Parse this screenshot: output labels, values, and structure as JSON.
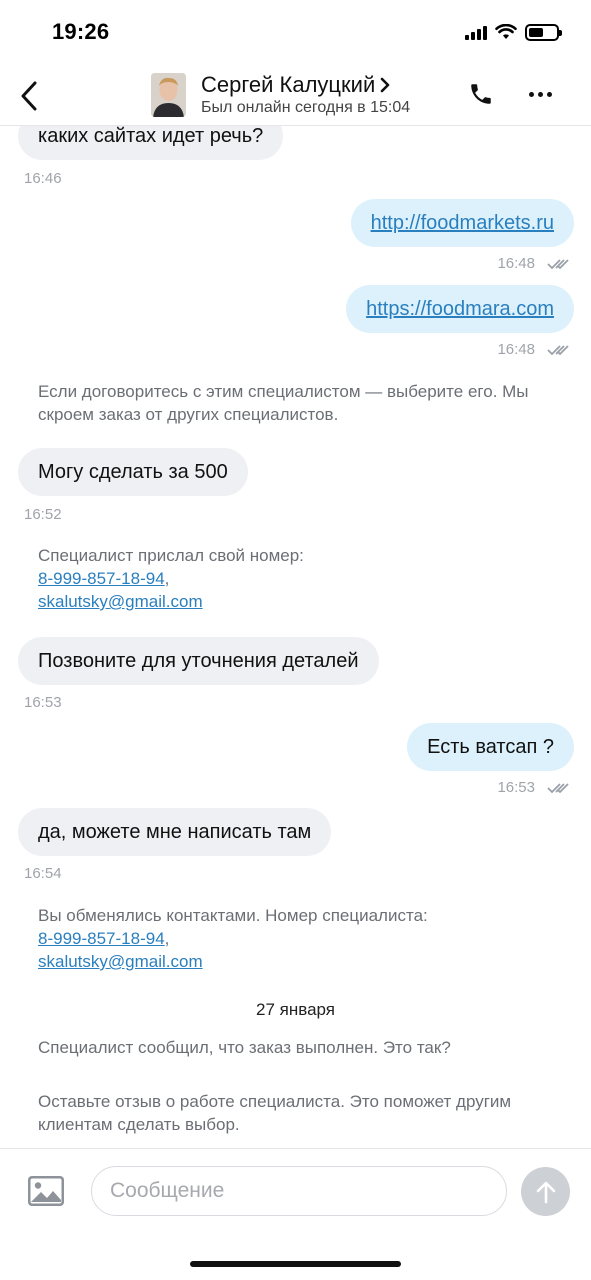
{
  "status_bar": {
    "time": "19:26",
    "battery_level": 0.55
  },
  "header": {
    "contact_name": "Сергей Калуцкий",
    "contact_status": "Был онлайн сегодня в 15:04",
    "icons": {
      "back": "chevron-left-icon",
      "call": "phone-icon",
      "more": "more-dots-icon",
      "name_chevron": "chevron-right-icon"
    }
  },
  "messages": {
    "m1_text": "каких сайтах идет речь?",
    "m1_time": "16:46",
    "m2_link": "http://foodmarkets.ru",
    "m2_time": "16:48",
    "m3_link": "https://foodmara.com",
    "m3_time": "16:48",
    "sys1": "Если договоритесь с этим специалистом — выберите его. Мы скроем заказ от других специалистов.",
    "m4_text": "Могу сделать за 500",
    "m4_time": "16:52",
    "sys2_text": "Специалист прислал свой номер:",
    "sys2_phone": "8-999-857-18-94",
    "sys2_email": "skalutsky@gmail.com",
    "m5_text": "Позвоните для уточнения деталей",
    "m5_time": "16:53",
    "m6_text": "Есть ватсап ?",
    "m6_time": "16:53",
    "m7_text": "да, можете мне написать там",
    "m7_time": "16:54",
    "sys3_text": "Вы обменялись контактами. Номер специалиста:",
    "sys3_phone": "8-999-857-18-94",
    "sys3_email": "skalutsky@gmail.com",
    "date_separator": "27 января",
    "sys4": "Специалист сообщил, что заказ выполнен. Это так?",
    "sys5": "Оставьте отзыв о работе специалиста. Это поможет другим клиентам сделать выбор."
  },
  "composer": {
    "placeholder": "Сообщение",
    "icons": {
      "attach": "image-icon",
      "send": "arrow-up-icon"
    }
  },
  "colors": {
    "outgoing_bubble": "#dcf1fb",
    "incoming_bubble": "#eef0f3",
    "link": "#2a7fbf"
  }
}
